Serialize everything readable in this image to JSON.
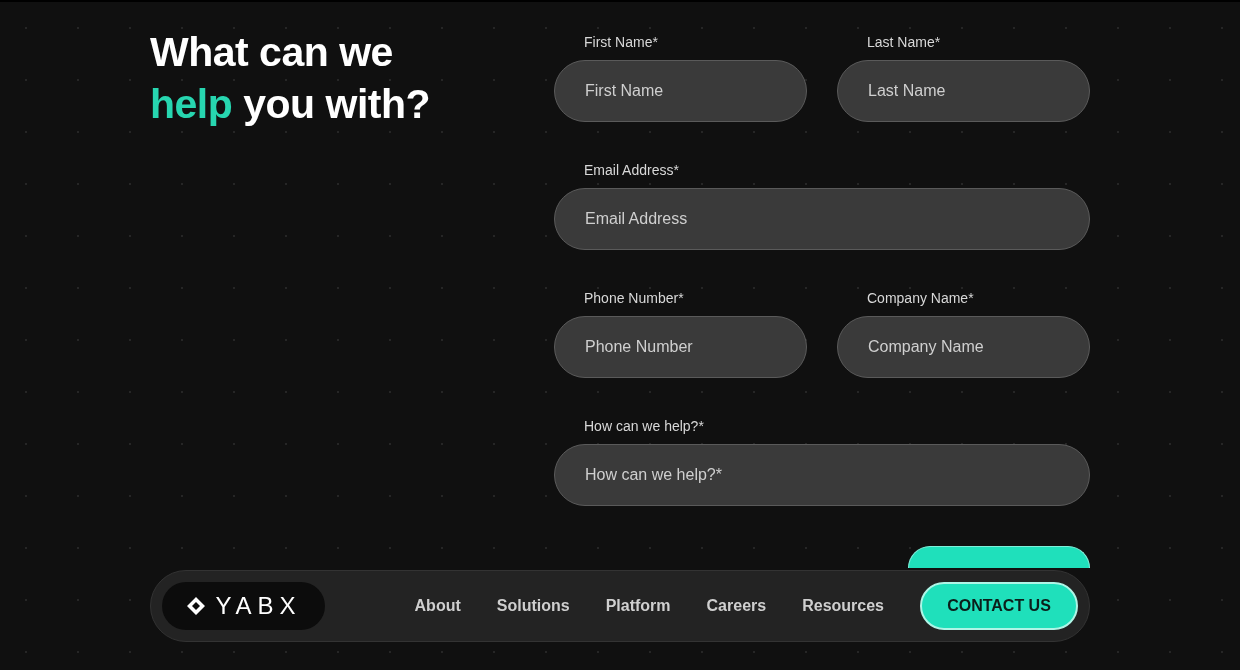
{
  "heading": [
    {
      "text": "What can we",
      "accent": false
    },
    {
      "text": "help",
      "accent": true
    },
    {
      "text": "you with?",
      "accent": false
    }
  ],
  "form": {
    "rows": [
      {
        "fields": [
          {
            "label": "First Name*",
            "placeholder": "First Name"
          },
          {
            "label": "Last Name*",
            "placeholder": "Last Name"
          }
        ]
      },
      {
        "fields": [
          {
            "label": "Email Address*",
            "placeholder": "Email Address"
          }
        ]
      },
      {
        "fields": [
          {
            "label": "Phone Number*",
            "placeholder": "Phone Number"
          },
          {
            "label": "Company Name*",
            "placeholder": "Company Name"
          }
        ]
      },
      {
        "fields": [
          {
            "label": "How can we help?*",
            "placeholder": "How can we help?*"
          }
        ]
      }
    ]
  },
  "navbar": {
    "logo": "YABX",
    "links": [
      "About",
      "Solutions",
      "Platform",
      "Careers",
      "Resources"
    ],
    "cta": "CONTACT US"
  }
}
